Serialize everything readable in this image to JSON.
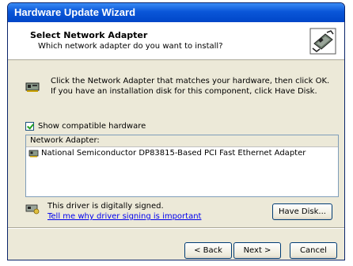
{
  "window": {
    "title": "Hardware Update Wizard"
  },
  "header": {
    "title": "Select Network Adapter",
    "subtitle": "Which network adapter do you want to install?",
    "icon": "network-card-icon"
  },
  "intro": {
    "text": "Click the Network Adapter that matches your hardware, then click OK. If you have an installation disk for this component, click Have Disk.",
    "icon": "network-adapter-icon"
  },
  "compatible": {
    "label": "Show compatible hardware",
    "checked": true
  },
  "list": {
    "header": "Network Adapter:",
    "items": [
      {
        "label": "National Semiconductor DP83815-Based PCI Fast Ethernet Adapter",
        "icon": "network-adapter-icon"
      }
    ]
  },
  "signature": {
    "text": "This driver is digitally signed.",
    "link": "Tell me why driver signing is important",
    "icon": "signed-driver-icon"
  },
  "buttons": {
    "have_disk": "Have Disk...",
    "back": "< Back",
    "next": "Next >",
    "cancel": "Cancel"
  }
}
